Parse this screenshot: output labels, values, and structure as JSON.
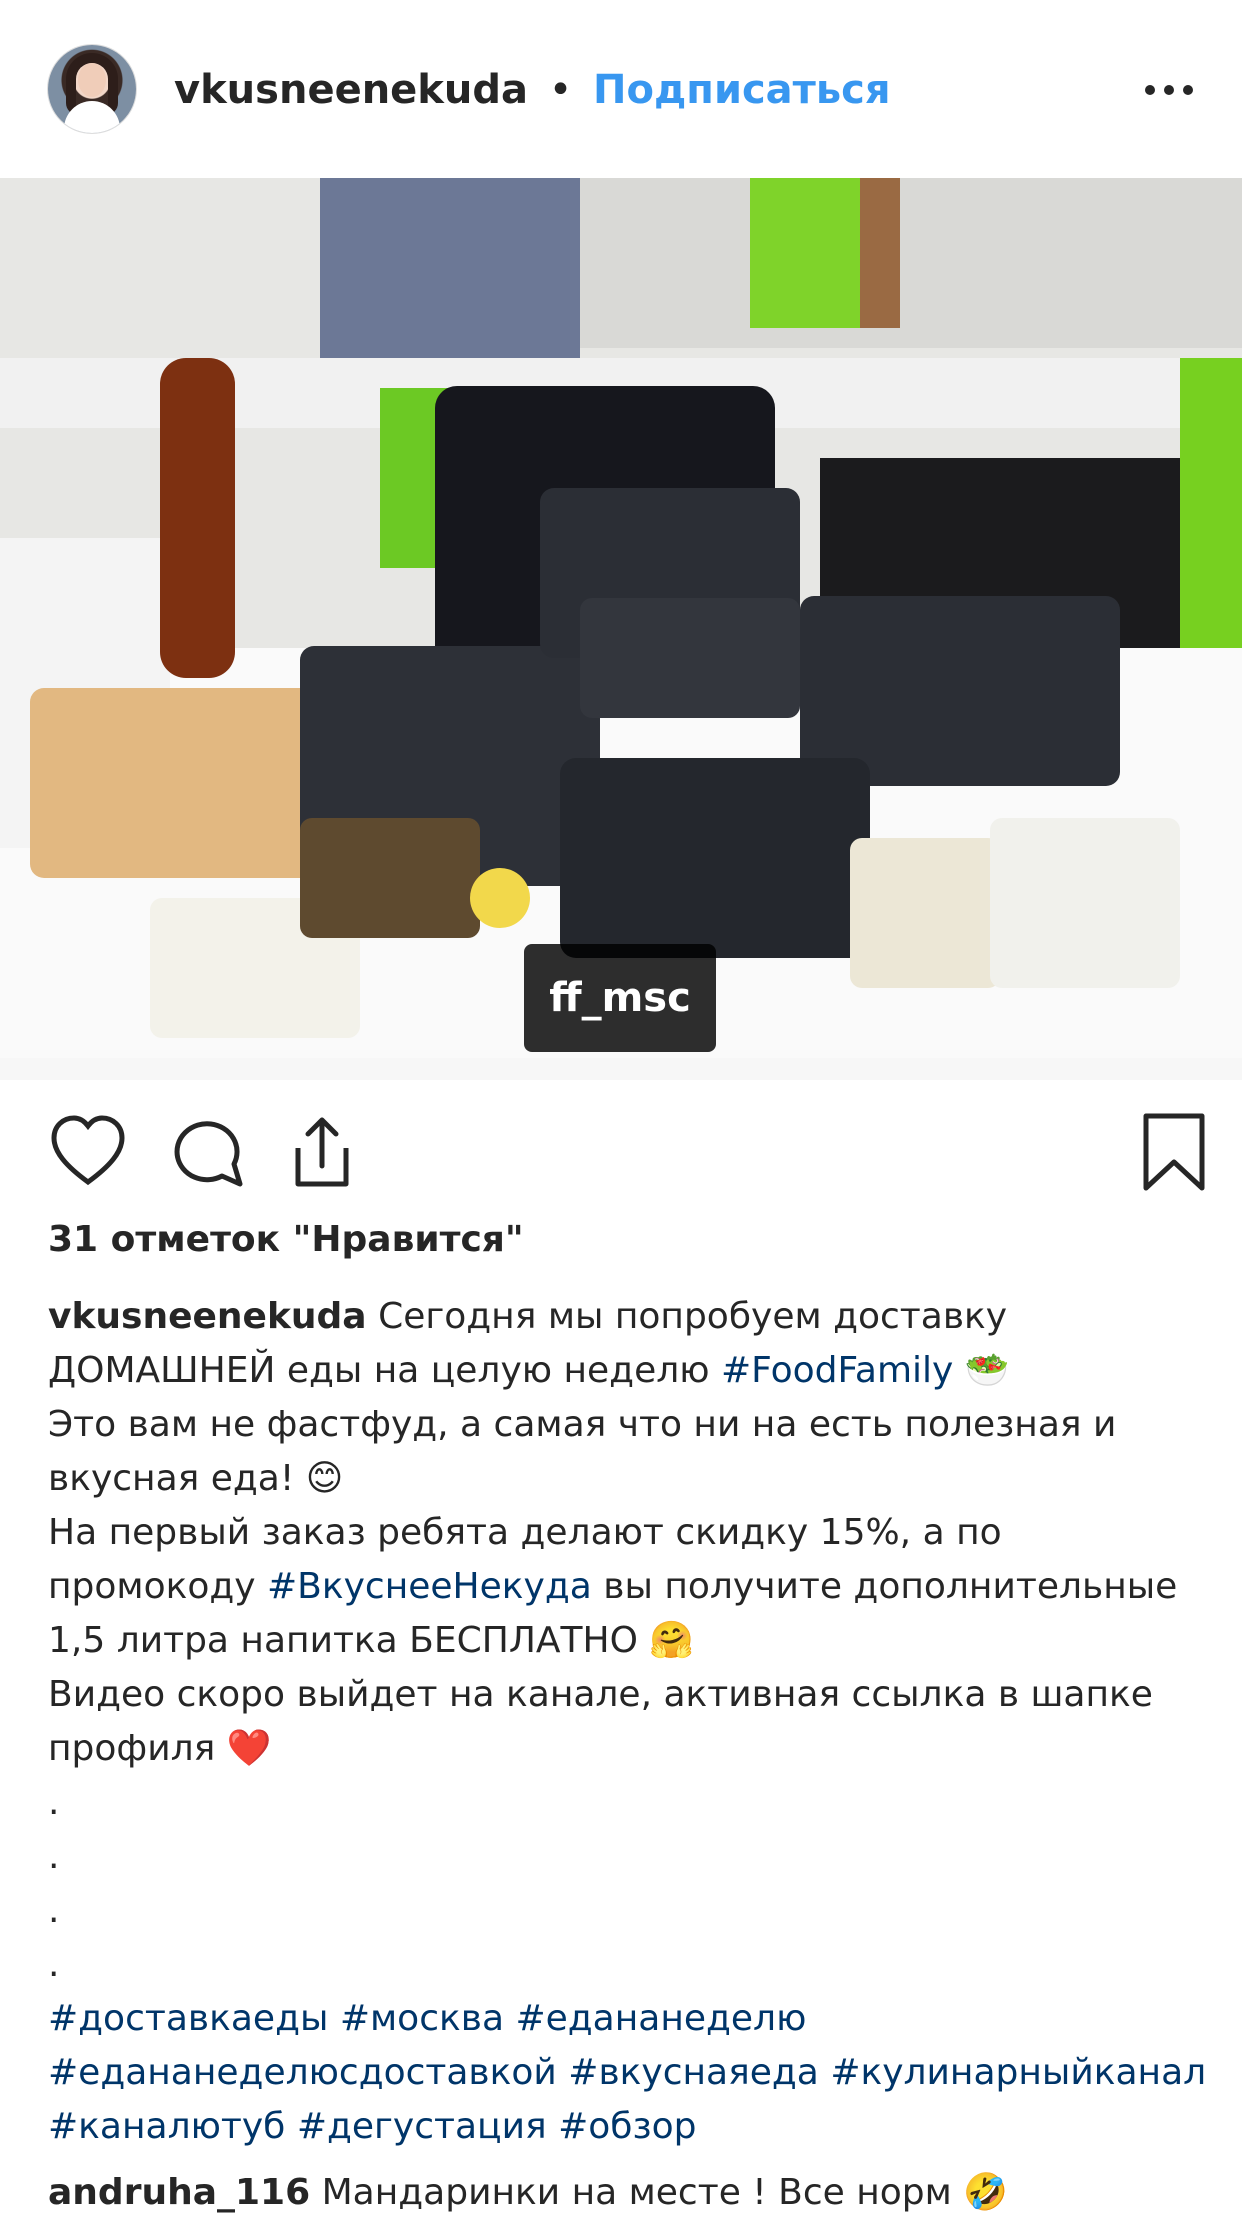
{
  "post": {
    "username": "vkusneenekuda",
    "separator": "•",
    "follow_label": "Подписаться",
    "tag_label": "ff_msc",
    "likes": "31 отметок \"Нравится\"",
    "caption_lines": [
      "Сегодня мы попробуем доставку",
      "ДОМАШНЕЙ еды на целую неделю",
      "#FoodFamily",
      "🥗",
      "Это вам не фастфуд, а самая что ни на есть полезная и",
      "вкусная еда!",
      "😊",
      "На первый заказ ребята делают скидку 15%, а по",
      "промокоду",
      "#ВкуснееНекуда",
      "вы получите дополнительные",
      "1,5 литра напитка БЕСПЛАТНО",
      "🤗",
      "Видео скоро выйдет на канале, активная ссылка в шапке",
      "профиля",
      "❤️",
      ".",
      ".",
      ".",
      "."
    ],
    "hashtag_lines": [
      [
        "#доставкаеды",
        "#москва",
        "#едананеделю"
      ],
      [
        "#едананеделюсдоставкой",
        "#вкуснаяеда",
        "#кулинарныйканал"
      ],
      [
        "#каналютуб",
        "#дегустация",
        "#обзор"
      ]
    ],
    "comment": {
      "username": "andruha_116",
      "text": "Мандаринки на месте ! Все норм",
      "emoji": "🤣"
    }
  },
  "icons": {
    "more": "more-horizontal-icon",
    "like": "heart-icon",
    "comment": "comment-bubble-icon",
    "share": "share-icon",
    "save": "bookmark-icon",
    "user_tag": "user-icon"
  },
  "colors": {
    "link": "#3897f0",
    "hashtag": "#003569",
    "text": "#262626"
  }
}
